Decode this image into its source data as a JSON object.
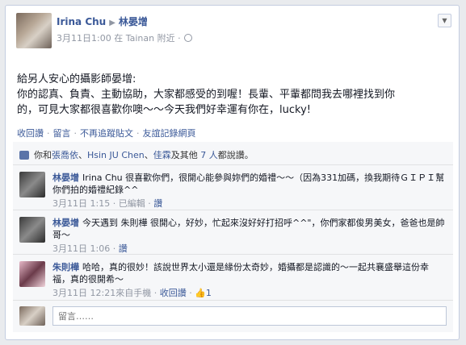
{
  "post": {
    "author": "Irina Chu",
    "target": "林晏增",
    "meta": "3月11日1:00 在 Tainan 附近 ·",
    "text_lines": [
      "給另人安心的攝影師晏增:",
      "你的認真、負責、主動協助，大家都感受的到喔！長輩、平輩都問我去哪裡找到你",
      "的，可見大家都很喜歡你噢～～今天我們好幸運有你在，lucky!"
    ],
    "actions": [
      "收回讚",
      "留言",
      "不再追蹤貼文",
      "友誼記錄網頁"
    ]
  },
  "likes": {
    "prefix": "你和",
    "names": [
      "張喬依",
      "Hsin JU Chen",
      "佳霖"
    ],
    "middle": "及其他",
    "others": "7 人",
    "suffix": "都說讚。"
  },
  "comments": [
    {
      "author": "林晏增",
      "text": "Irina Chu 很喜歡你們，很開心能參與妳們的婚禮～～（因為331加碼，換我期待ＧＩＰＩ幫你們拍的婚禮紀錄^^",
      "time": "3月11日 1:15",
      "extra": "已編輯",
      "action": "讚"
    },
    {
      "author": "林晏增",
      "text": "今天遇到 朱則樺 很開心，好妙，忙起來沒好好打招呼^^\"，你們家都俊男美女，爸爸也是帥哥～",
      "time": "3月11日 1:06",
      "action": "讚"
    },
    {
      "author": "朱則樺",
      "text": "哈哈，真的很妙！該說世界太小還是緣份太奇妙，婚攝都是認識的～一起共襄盛舉這份幸福，真的很開希～",
      "time": "3月11日 12:21",
      "device": "來自手機",
      "action": "收回讚",
      "likes": "1"
    }
  ],
  "compose": {
    "placeholder": "留言……"
  },
  "colors": {
    "link": "#3b5998",
    "ufi_bg": "#f6f7f9",
    "border": "#c4cde0"
  }
}
